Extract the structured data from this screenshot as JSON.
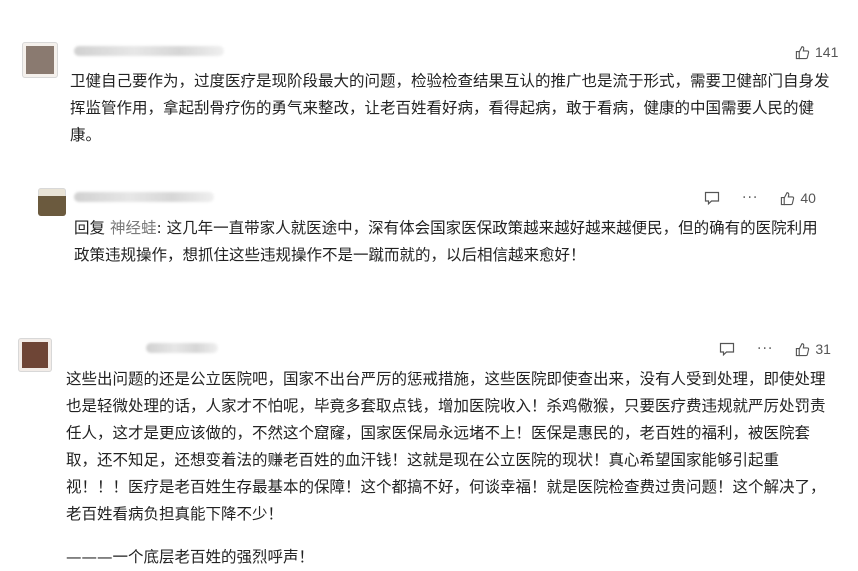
{
  "comments": [
    {
      "likes": "141",
      "text": "卫健自己要作为，过度医疗是现阶段最大的问题，检验检查结果互认的推广也是流于形式，需要卫健部门自身发挥监管作用，拿起刮骨疗伤的勇气来整改，让老百姓看好病，看得起病，敢于看病，健康的中国需要人民的健康。"
    },
    {
      "likes": "40",
      "reply_prefix": "回复",
      "reply_to": "神经蛙",
      "text": ": 这几年一直带家人就医途中，深有体会国家医保政策越来越好越来越便民，但的确有的医院利用政策违规操作，想抓住这些违规操作不是一蹴而就的，以后相信越来愈好！"
    },
    {
      "likes": "31",
      "text": "这些出问题的还是公立医院吧，国家不出台严厉的惩戒措施，这些医院即使查出来，没有人受到处理，即使处理也是轻微处理的话，人家才不怕呢，毕竟多套取点钱，增加医院收入！杀鸡儆猴，只要医疗费违规就严厉处罚责任人，这才是更应该做的，不然这个窟窿，国家医保局永远堵不上！医保是惠民的，老百姓的福利，被医院套取，还不知足，还想变着法的赚老百姓的血汗钱！这就是现在公立医院的现状！真心希望国家能够引起重视！！！医疗是老百姓生存最基本的保障！这个都搞不好，何谈幸福！就是医院检查费过贵问题！这个解决了，老百姓看病负担真能下降不少！",
      "signature": "———一个底层老百姓的强烈呼声！"
    }
  ],
  "icons": {
    "reply": "reply-icon",
    "more": "more-icon",
    "like": "thumbs-up-icon"
  },
  "colors": {
    "text": "#222222",
    "mention": "#7a7a7a",
    "icon": "#555555",
    "avatar1": "#8a7a70",
    "avatar2": "#6b5a3e",
    "avatar3": "#6e4536"
  }
}
